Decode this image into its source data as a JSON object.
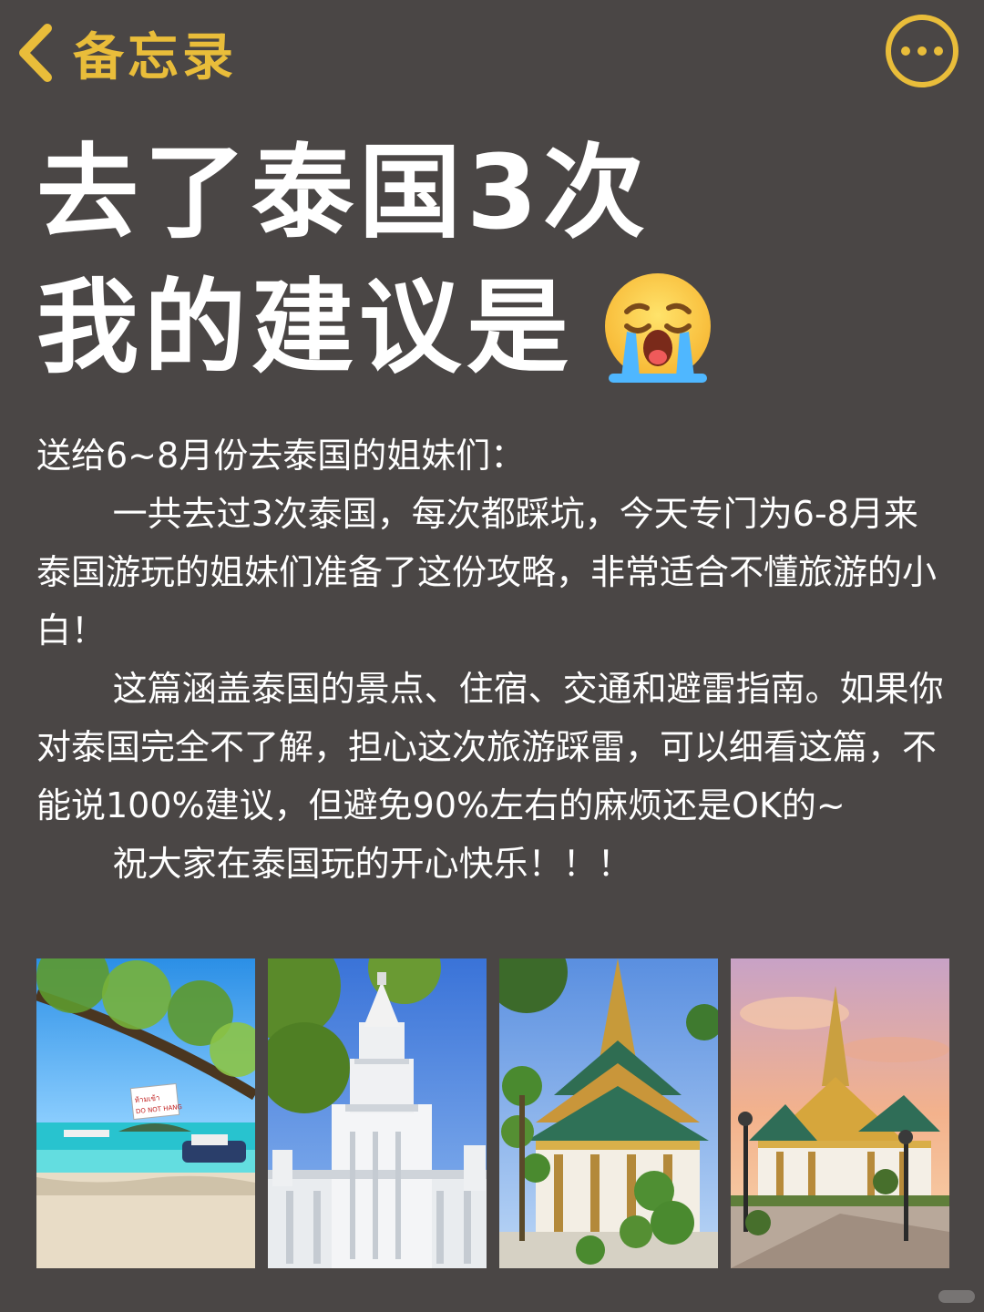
{
  "nav": {
    "back_label": "备忘录",
    "accent_color": "#e9bd3a",
    "back_icon": "chevron-left-icon",
    "more_icon": "more-horizontal-icon"
  },
  "title": {
    "line1": "去了泰国3次",
    "line2": "我的建议是",
    "emoji": "loudly-crying-face-emoji"
  },
  "body": {
    "p1": "送给6~8月份去泰国的姐妹们：",
    "p2": "一共去过3次泰国，每次都踩坑，今天专门为6-8月来泰国游玩的姐妹们准备了这份攻略，非常适合不懂旅游的小白！",
    "p3": "这篇涵盖泰国的景点、住宿、交通和避雷指南。如果你对泰国完全不了解，担心这次旅游踩雷，可以细看这篇，不能说100%建议，但避免90%左右的麻烦还是OK的~",
    "p4": "祝大家在泰国玩的开心快乐！！！"
  },
  "photos": {
    "photo1_sign": "ห้ามเข้า\nDO NOT HANG"
  },
  "background_color": "#4a4645"
}
